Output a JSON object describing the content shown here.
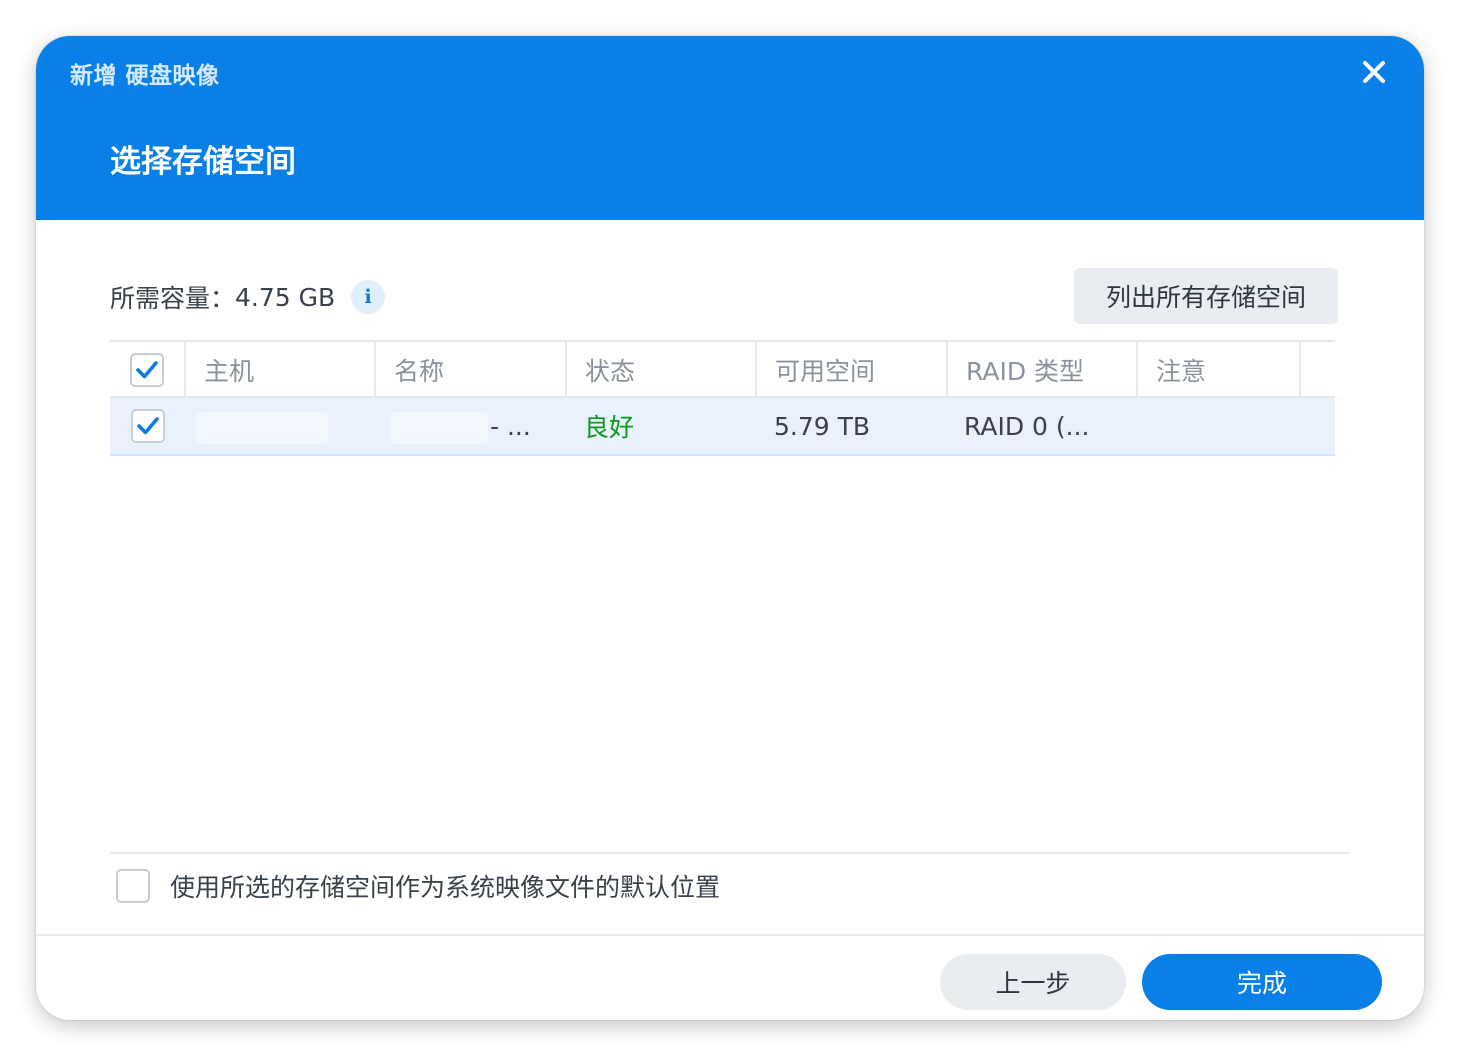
{
  "window": {
    "app_title": "新增 硬盘映像",
    "step_title": "选择存储空间",
    "close_icon": "close-icon"
  },
  "requirement": {
    "label": "所需容量：",
    "value": "4.75 GB",
    "info_icon_glyph": "i"
  },
  "toolbar": {
    "list_all_label": "列出所有存储空间"
  },
  "table": {
    "columns": [
      "主机",
      "名称",
      "状态",
      "可用空间",
      "RAID 类型",
      "注意"
    ],
    "rows": [
      {
        "selected": true,
        "host": "",
        "name": "- ...",
        "status": "良好",
        "free_space": "5.79 TB",
        "raid_type": "RAID 0 (...",
        "note": ""
      }
    ]
  },
  "options": {
    "default_location_label": "使用所选的存储空间作为系统映像文件的默认位置",
    "default_location_checked": false
  },
  "footer": {
    "prev_label": "上一步",
    "finish_label": "完成"
  },
  "colors": {
    "accent": "#0880e8",
    "status_good": "#0c9a1b",
    "selected_row": "#e8f1fc"
  }
}
